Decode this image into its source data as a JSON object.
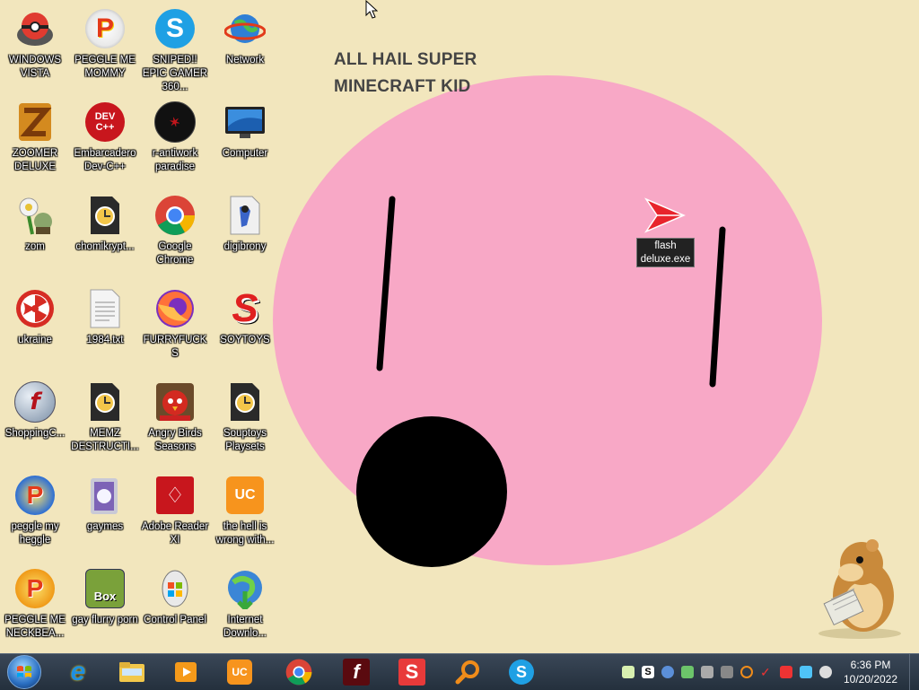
{
  "wallpaper": {
    "title": "ALL HAIL SUPER\nMINECRAFT KID"
  },
  "desktop_icons": [
    {
      "label": "WINDOWS VISTA",
      "icon": "pokeball-bowl-icon"
    },
    {
      "label": "PEGGLE ME MOMMY",
      "icon": "peggle-icon"
    },
    {
      "label": "SNIPED!! EPIC GAMER 360...",
      "icon": "skype-icon"
    },
    {
      "label": "Network",
      "icon": "network-globe-icon"
    },
    {
      "label": "ZOOMER DELUXE",
      "icon": "zuma-icon"
    },
    {
      "label": "Embarcadero Dev-C++",
      "icon": "devcpp-icon"
    },
    {
      "label": "r-antiwork paradise",
      "icon": "antiwork-icon"
    },
    {
      "label": "Computer",
      "icon": "computer-monitor-icon"
    },
    {
      "label": "zom",
      "icon": "plants-vs-zombies-icon"
    },
    {
      "label": "chomikrypt...",
      "icon": "clock-file-icon"
    },
    {
      "label": "Google Chrome",
      "icon": "chrome-icon"
    },
    {
      "label": "digibrony",
      "icon": "digibrony-icon"
    },
    {
      "label": "ukraine",
      "icon": "radiation-icon"
    },
    {
      "label": "1984.txt",
      "icon": "text-file-icon"
    },
    {
      "label": "FURRYFUCKS",
      "icon": "firefox-icon"
    },
    {
      "label": "SOYTOYS",
      "icon": "soytoys-icon"
    },
    {
      "label": "ShoppingC...",
      "icon": "flash-player-icon"
    },
    {
      "label": "MEMZ DESTRUCTI...",
      "icon": "clock-file-icon"
    },
    {
      "label": "Angry Birds Seasons",
      "icon": "angry-birds-icon"
    },
    {
      "label": "Souptoys Playsets",
      "icon": "clock-file-icon"
    },
    {
      "label": "peggle my heggle",
      "icon": "peggle-icon"
    },
    {
      "label": "gaymes",
      "icon": "games-folder-icon"
    },
    {
      "label": "Adobe Reader XI",
      "icon": "adobe-reader-icon"
    },
    {
      "label": "the hell is wrong with...",
      "icon": "uc-browser-icon"
    },
    {
      "label": "PEGGLE ME NECKBEA...",
      "icon": "peggle-icon"
    },
    {
      "label": "gay flurry porn",
      "icon": "boxed-hamster-icon"
    },
    {
      "label": "Control Panel",
      "icon": "control-panel-icon"
    },
    {
      "label": "Internet Downlo...",
      "icon": "internet-download-manager-icon"
    }
  ],
  "floating_item": {
    "label": "flash deluxe.exe",
    "icon": "red-arrow-icon"
  },
  "taskbar": {
    "pinned": [
      {
        "name": "internet-explorer"
      },
      {
        "name": "file-explorer"
      },
      {
        "name": "media-player"
      },
      {
        "name": "uc-browser"
      },
      {
        "name": "google-chrome"
      },
      {
        "name": "flash-player"
      },
      {
        "name": "soytoys"
      },
      {
        "name": "search-magnifier"
      },
      {
        "name": "skype"
      }
    ],
    "clock_time": "6:36 PM",
    "clock_date": "10/20/2022"
  },
  "colors": {
    "desktop_bg": "#f2e6bd",
    "face": "#f8a8c6",
    "taskbar": "#2c3846"
  }
}
